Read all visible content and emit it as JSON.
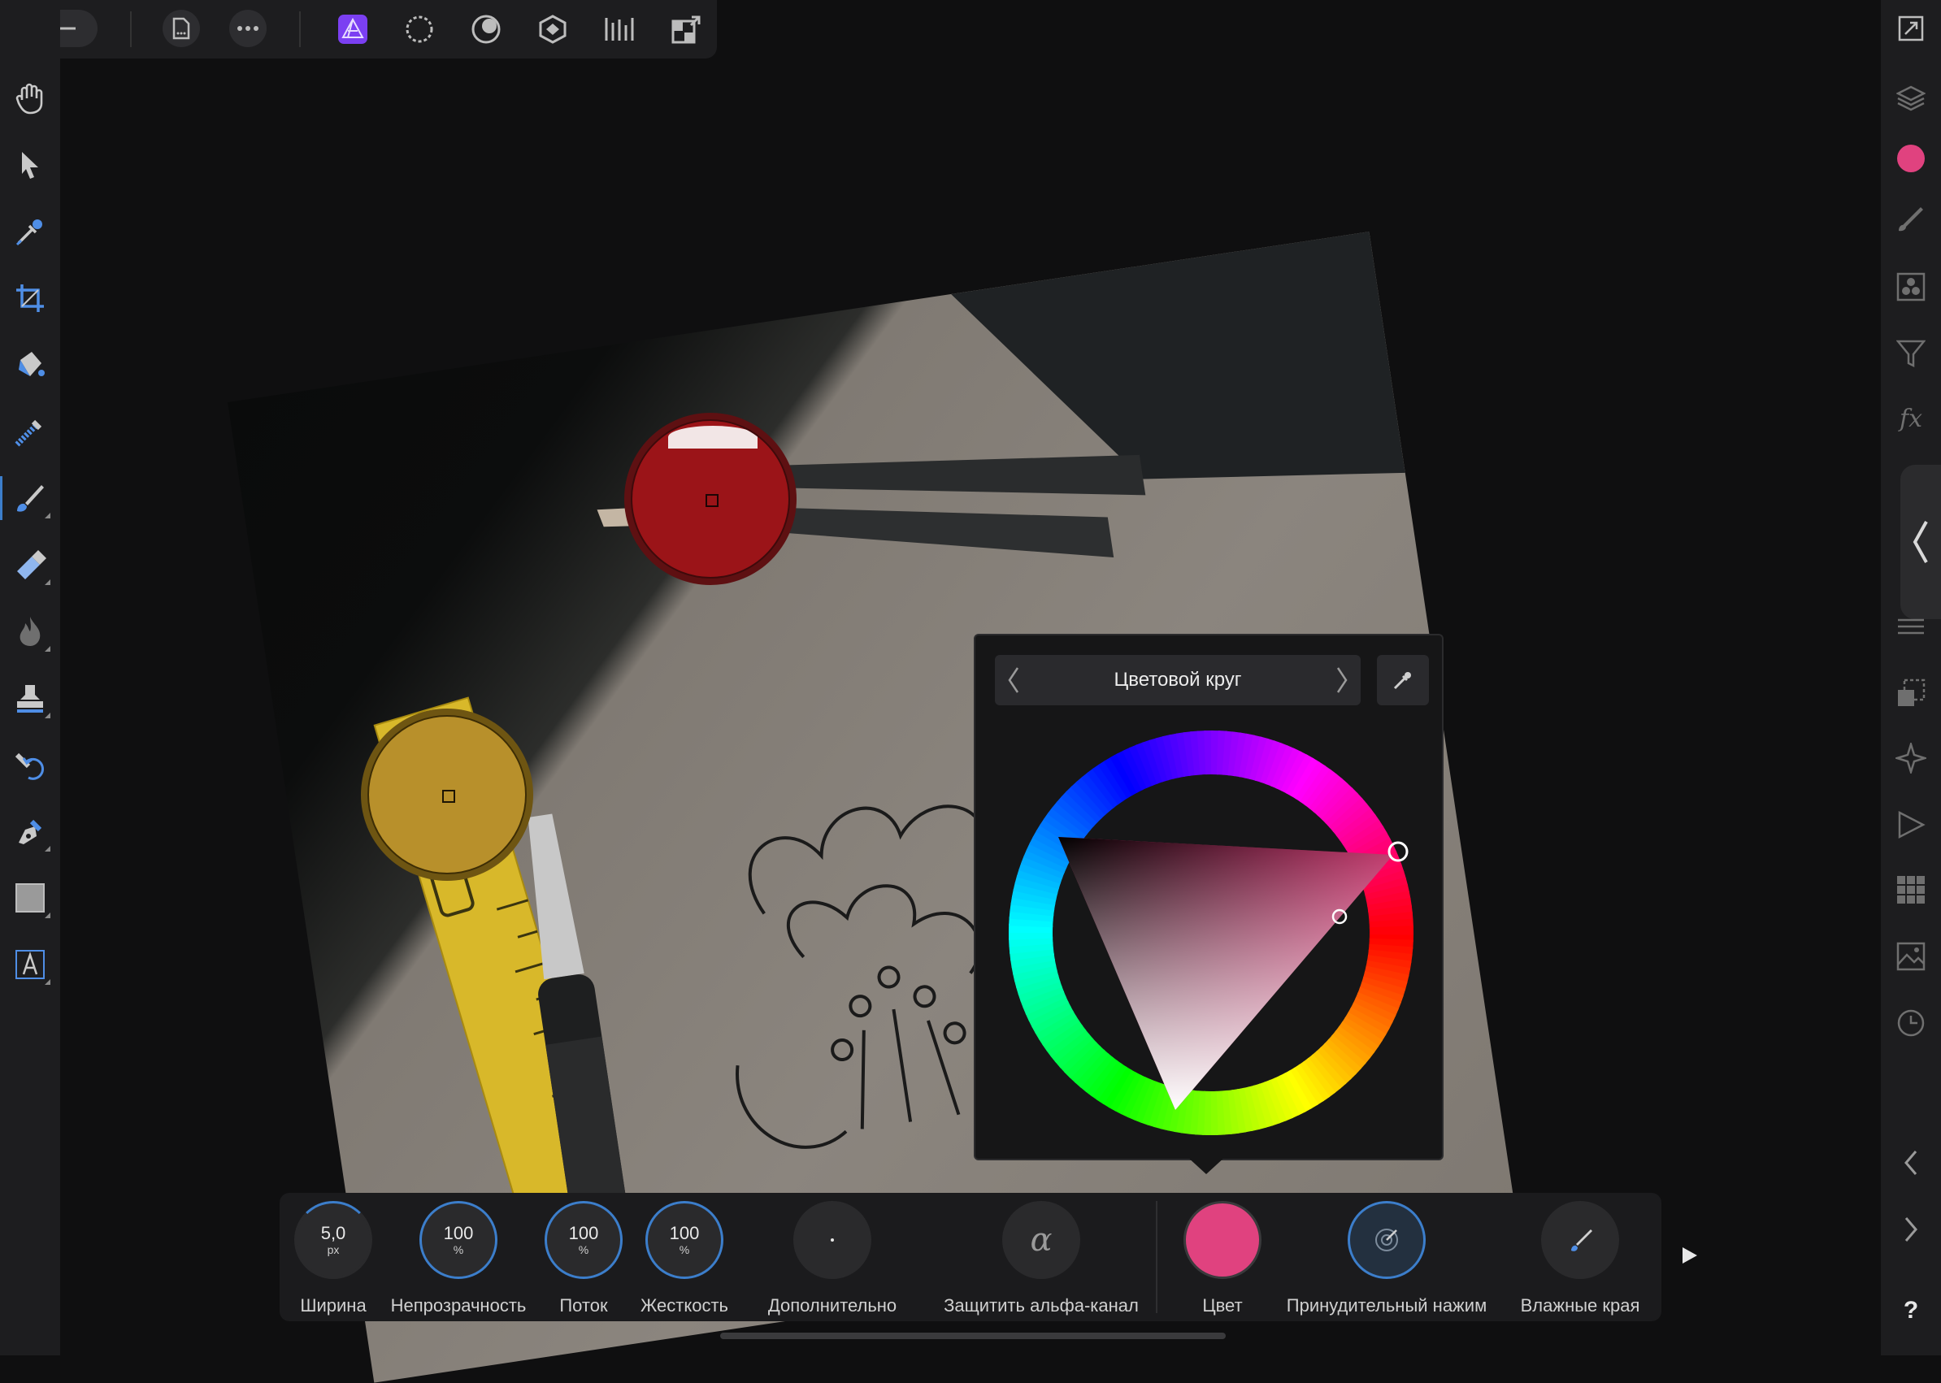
{
  "colors": {
    "ui_bg": "#1d1d1f",
    "canvas_bg": "#0f0f10",
    "accent_ring": "#3c7ecb",
    "current_color": "#e0427f",
    "persona_active": "#7b3ff2",
    "red_loupe": "#9b1418",
    "yellow_loupe": "#b8902b"
  },
  "top_toolbar": {
    "icons": [
      "back-arrow-icon",
      "document-icon",
      "more-icon",
      "photo-persona-icon",
      "liquify-persona-icon",
      "develop-persona-icon",
      "tone-mapping-persona-icon",
      "export-persona-icon",
      "transform-icon"
    ]
  },
  "left_tools": [
    "view-tool",
    "move-tool",
    "color-picker-tool",
    "crop-tool",
    "flood-fill-tool",
    "selection-brush-tool",
    "paint-brush-tool",
    "erase-brush-tool",
    "burn-tool",
    "clone-tool",
    "undo-brush-tool",
    "pen-tool",
    "rectangle-tool",
    "text-tool"
  ],
  "right_studio": [
    "canvas-fit",
    "layers",
    "color",
    "brushes",
    "channels",
    "adjustments",
    "effects",
    "navigator",
    "transform",
    "macros",
    "swatches",
    "stock",
    "history",
    "scroll-left",
    "scroll-right",
    "help"
  ],
  "right_studio_help": "?",
  "color_panel": {
    "mode_title": "Цветовой круг"
  },
  "context_toolbar": {
    "width": {
      "value": "5,0",
      "unit": "px",
      "label": "Ширина"
    },
    "opacity": {
      "value": "100",
      "unit": "%",
      "label": "Непрозрачность"
    },
    "flow": {
      "value": "100",
      "unit": "%",
      "label": "Поток"
    },
    "hardness": {
      "value": "100",
      "unit": "%",
      "label": "Жесткость"
    },
    "more": {
      "label": "Дополнительно"
    },
    "protect_alpha": {
      "label": "Защитить альфа-канал"
    },
    "color": {
      "label": "Цвет"
    },
    "force_pressure": {
      "label": "Принудительный нажим"
    },
    "wet_edges": {
      "label": "Влажные края"
    }
  }
}
